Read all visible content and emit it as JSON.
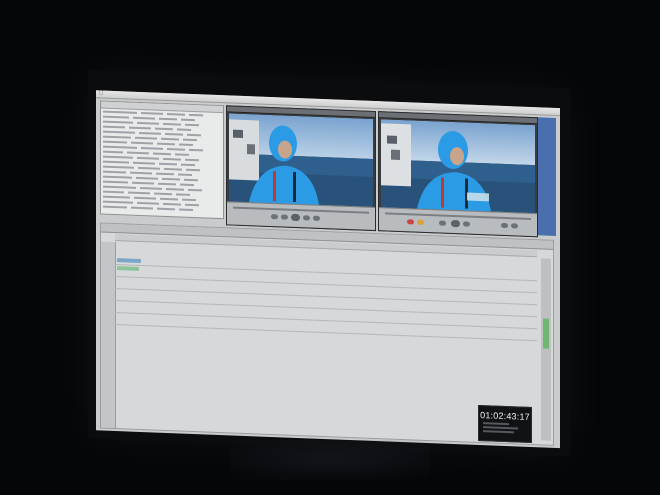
{
  "timecode": {
    "value": "01:02:43:17"
  },
  "colors": {
    "sky": "#8fb3d7",
    "sea": "#2f5f8c",
    "jacket": "#2b9be5",
    "panel": "#c9cbcc",
    "timecode_bg": "#101214"
  },
  "icons": [
    "apple-icon"
  ]
}
